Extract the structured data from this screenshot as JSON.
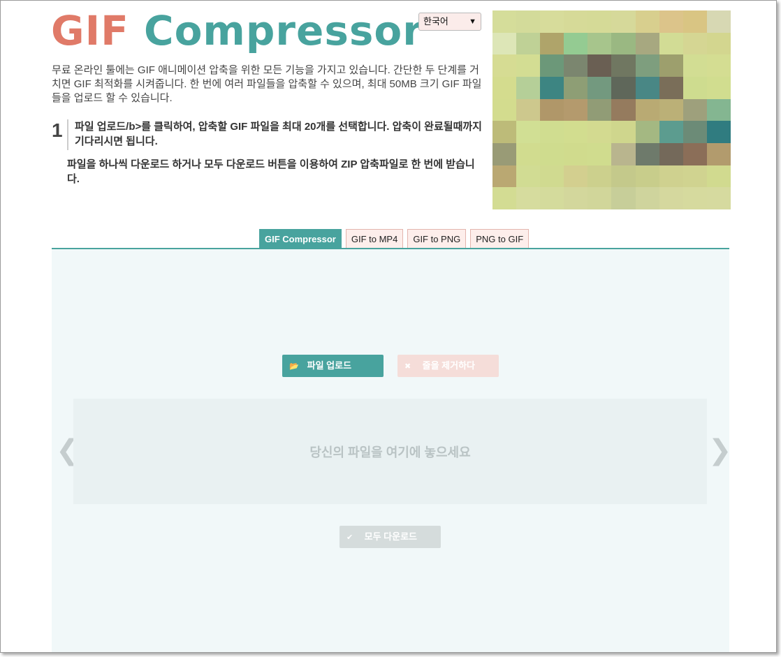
{
  "header": {
    "logo_gif": "GIF",
    "logo_compressor": "Compressor",
    "language": "한국어"
  },
  "intro": "무료 온라인 툴에는 GIF 애니메이션 압축을 위한 모든 기능을 가지고 있습니다. 간단한 두 단계를 거치면 GIF 최적화를 시켜줍니다. 한 번에 여러 파일들을 압축할 수 있으며, 최대 50MB 크기 GIF 파일들을 업로드 할 수 있습니다.",
  "steps": {
    "number": "1",
    "text1": "파일 업로드/b>를 클릭하여, 압축할 GIF 파일을 최대 20개를 선택합니다. 압축이 완료될때까지 기다리시면 됩니다.",
    "text2": "파일을 하나씩 다운로드 하거나 모두 다운로드 버튼을 이용하여 ZIP 압축파일로 한 번에 받습니다."
  },
  "tabs": [
    {
      "label": "GIF Compressor",
      "active": true
    },
    {
      "label": "GIF to MP4",
      "active": false
    },
    {
      "label": "GIF to PNG",
      "active": false
    },
    {
      "label": "PNG to GIF",
      "active": false
    }
  ],
  "toolbar": {
    "upload_label": "파일 업로드",
    "remove_label": "줄을 제거하다",
    "download_all_label": "모두 다운로드"
  },
  "dropzone": {
    "text": "당신의 파일을 여기에 놓으세요"
  },
  "icons": {
    "upload": "folder-open-icon",
    "remove": "close-icon",
    "download": "check-icon",
    "prev": "chevron-left-icon",
    "next": "chevron-right-icon"
  },
  "colors": {
    "accent": "#48a39e",
    "logo_gif": "#e07a68",
    "tab_inactive_bg": "#fdeeeb",
    "panel_bg": "#f1f8f9"
  },
  "mosaic_colors": [
    "#d5dd9a",
    "#d3db9a",
    "#d7dc9b",
    "#d6da98",
    "#d5da97",
    "#d6d99a",
    "#d8cf8e",
    "#dcc48a",
    "#d9c583",
    "#d7d8b3",
    "#dde6b7",
    "#bfd196",
    "#afa46a",
    "#94cb92",
    "#a7c58c",
    "#9ab882",
    "#a7a880",
    "#d2dc95",
    "#d5d693",
    "#d3d68f",
    "#d6dc93",
    "#d3dd93",
    "#6c9879",
    "#7b866f",
    "#6a5f53",
    "#707761",
    "#7e9e7e",
    "#9d9f6d",
    "#d2dd93",
    "#d4dd92",
    "#d4dc8e",
    "#b5cf98",
    "#3d8582",
    "#8e9e75",
    "#73997f",
    "#5f675a",
    "#498785",
    "#7a6e59",
    "#cedc8f",
    "#d1dd8f",
    "#d3dc8e",
    "#cdc88d",
    "#b09769",
    "#b49a6d",
    "#919c76",
    "#957b5e",
    "#b9aa73",
    "#bbb077",
    "#9ea07c",
    "#84b691",
    "#bdbb79",
    "#d1df94",
    "#d0dd90",
    "#d2dd8f",
    "#d3da90",
    "#cfd68d",
    "#a4b882",
    "#5c9c8f",
    "#6c8b77",
    "#307c80",
    "#999b76",
    "#d1dc8f",
    "#cfdc8e",
    "#d0db8d",
    "#d0dc8e",
    "#b9b58e",
    "#6e7a6b",
    "#74695a",
    "#8b6e58",
    "#b29b6d",
    "#baa872",
    "#d1dc93",
    "#d0da90",
    "#d3cf8f",
    "#ccd08d",
    "#c4c98b",
    "#c8cd8b",
    "#cfd18f",
    "#d0d390",
    "#d1da8f",
    "#d3dc93",
    "#d6dc9e",
    "#d4db9c",
    "#d3d79c",
    "#d1d69a",
    "#c7ce99",
    "#cfd49d",
    "#d5d89e",
    "#d6da9e",
    "#d6da9f",
    "#d7dca0"
  ]
}
